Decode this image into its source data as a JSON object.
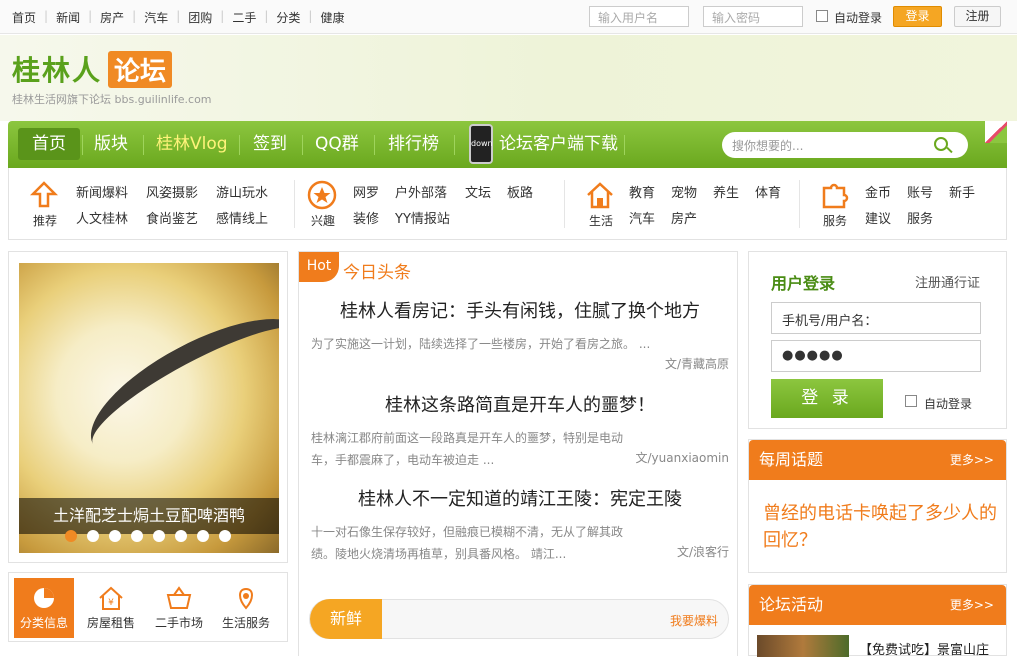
{
  "topbar": {
    "links": [
      "首页",
      "新闻",
      "房产",
      "汽车",
      "团购",
      "二手",
      "分类",
      "健康"
    ],
    "username_placeholder": "输入用户名",
    "password_placeholder": "输入密码",
    "auto_login": "自动登录",
    "login": "登录",
    "register": "注册"
  },
  "brand": {
    "name_part1": "桂林人",
    "name_part2": "论坛",
    "slogan": "桂林生活网旗下论坛  bbs.guilinlife.com"
  },
  "nav": {
    "items": [
      "首页",
      "版块",
      "桂林Vlog",
      "签到",
      "QQ群",
      "排行榜"
    ],
    "app_download": "论坛客户端下载",
    "phone_text": "down",
    "search_placeholder": "搜你想要的..."
  },
  "categories": [
    {
      "icon": "推荐",
      "links": [
        "新闻爆料",
        "风姿摄影",
        "游山玩水",
        "人文桂林",
        "食尚鉴艺",
        "感情线上"
      ]
    },
    {
      "icon": "兴趣",
      "links": [
        "网罗",
        "户外部落",
        "文坛",
        "板路",
        "装修",
        "YY情报站"
      ]
    },
    {
      "icon": "生活",
      "links": [
        "教育",
        "宠物",
        "养生",
        "体育",
        "汽车",
        "房产"
      ]
    },
    {
      "icon": "服务",
      "links": [
        "金币",
        "账号",
        "新手",
        "建议",
        "服务"
      ]
    }
  ],
  "slider": {
    "caption": "土洋配芝士焗土豆配啤酒鸭",
    "dot_count": 8,
    "active_dot": 0
  },
  "services": [
    "分类信息",
    "房屋租售",
    "二手市场",
    "生活服务"
  ],
  "headlines": {
    "hot": "Hot",
    "title": "今日头条",
    "items": [
      {
        "title": "桂林人看房记：手头有闲钱，住腻了换个地方",
        "desc": "为了实施这一计划，陆续选择了一些楼房，开始了看房之旅。 ...",
        "author": "文/青藏高原"
      },
      {
        "title": "桂林这条路简直是开车人的噩梦！",
        "desc": "桂林漓江郡府前面这一段路真是开车人的噩梦，特别是电动车，手都震麻了，电动车被迫走 ...",
        "author": "文/yuanxiaomin"
      },
      {
        "title": "桂林人不一定知道的靖江王陵：宪定王陵",
        "desc": "十一对石像生保存较好，但融痕已模糊不清，无从了解其政绩。陵地火烧清场再植草，别具番风格。     靖江...",
        "author": "文/浪客行"
      }
    ],
    "fresh": "新鲜",
    "fresh_more": "我要爆料"
  },
  "login_panel": {
    "title": "用户登录",
    "register_link": "注册通行证",
    "username_placeholder": "手机号/用户名：",
    "password_value": "●●●●●",
    "button": "登 录",
    "auto_login": "自动登录"
  },
  "weekly_topic": {
    "title": "每周话题",
    "more": "更多>>",
    "question": "曾经的电话卡唤起了多少人的回忆？"
  },
  "forum_activity": {
    "title": "论坛活动",
    "more": "更多>>",
    "first_item": "【免费试吃】景富山庄"
  }
}
